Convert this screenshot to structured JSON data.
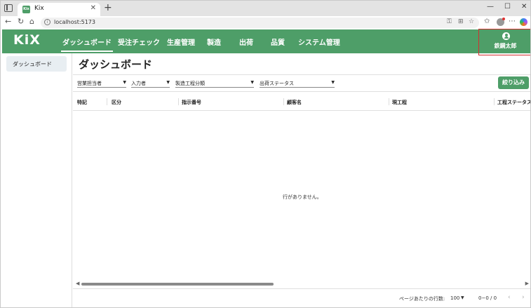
{
  "browser": {
    "tab_title": "Kix",
    "url": "localhost:5173",
    "tab_close": "✕",
    "new_tab": "+",
    "window_controls": [
      "—",
      "☐",
      "✕"
    ]
  },
  "app": {
    "logo": "KiX",
    "brand_color": "#4e9e68",
    "nav": [
      "ダッシュボード",
      "受注チェック",
      "生産管理",
      "製造",
      "出荷",
      "品質",
      "システム管理"
    ],
    "user_name": "鉄鋼太郎"
  },
  "sidebar": {
    "items": [
      {
        "label": "ダッシュボード"
      }
    ]
  },
  "main": {
    "title": "ダッシュボード",
    "filters": [
      "営業担当者",
      "入力者",
      "製造工程分類",
      "出荷ステータス"
    ],
    "apply_label": "絞り込み",
    "columns": [
      "特記",
      "区分",
      "指示番号",
      "顧客名",
      "現工程",
      "工程ステータス"
    ],
    "empty_message": "行がありません。",
    "footer": {
      "rows_per_page_label": "ページあたりの行数:",
      "rows_per_page_value": "100",
      "range": "0−0 / 0"
    }
  }
}
